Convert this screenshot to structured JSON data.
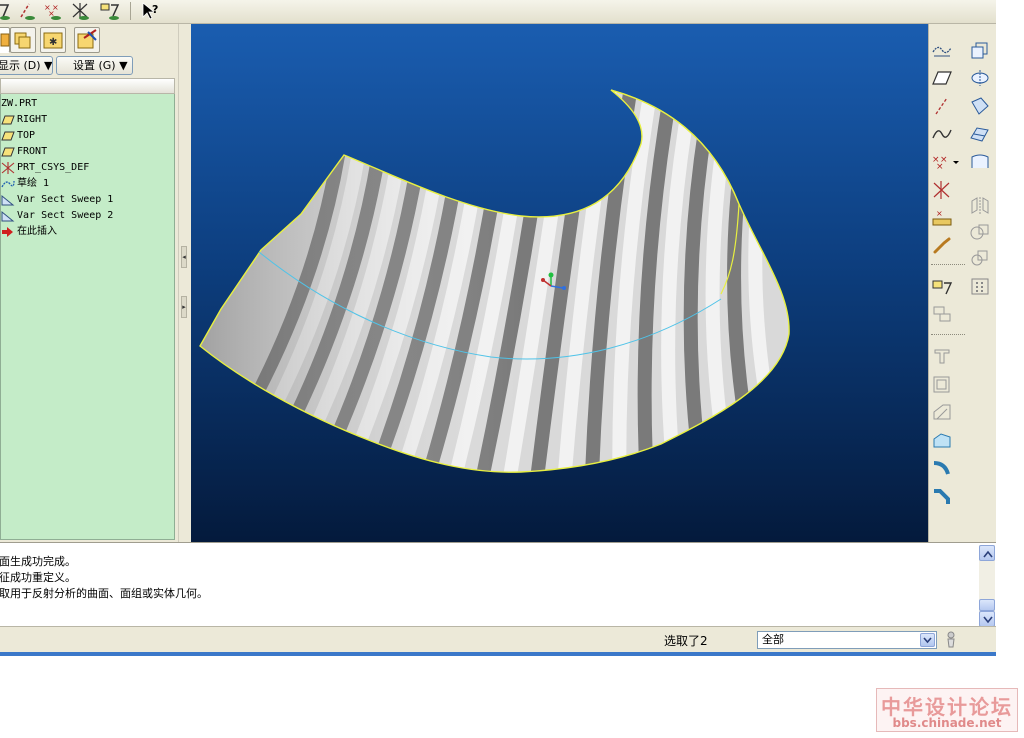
{
  "model_panel": {
    "show_menu_label": "显示 (D) ▼",
    "settings_menu_label": "设置 (G) ▼",
    "tree_items": [
      {
        "label": "ZW.PRT",
        "icon": "part-icon"
      },
      {
        "label": "RIGHT",
        "icon": "datum-plane-icon"
      },
      {
        "label": "TOP",
        "icon": "datum-plane-icon"
      },
      {
        "label": "FRONT",
        "icon": "datum-plane-icon"
      },
      {
        "label": "PRT_CSYS_DEF",
        "icon": "coordinate-system-icon"
      },
      {
        "label": "草绘 1",
        "icon": "sketch-icon"
      },
      {
        "label": "Var Sect Sweep 1",
        "icon": "sweep-icon"
      },
      {
        "label": "Var Sect Sweep 2",
        "icon": "sweep-icon"
      },
      {
        "label": "在此插入",
        "icon": "insert-here-arrow-icon"
      }
    ]
  },
  "messages": [
    "曲面生成功完成。",
    "特征成功重定义。",
    "选取用于反射分析的曲面、面组或实体几何。"
  ],
  "status": {
    "selected_text": "选取了2",
    "filter_value": "全部"
  },
  "watermark": {
    "line1": "中华设计论坛",
    "line2": "bbs.chinade.net"
  },
  "colors": {
    "model_tree_bg": "#c4ecc8",
    "viewport_top": "#1a5db0",
    "viewport_bottom": "#041a3c",
    "surface_edge": "#e8f040",
    "boundary_curve": "#4fc3e8"
  }
}
